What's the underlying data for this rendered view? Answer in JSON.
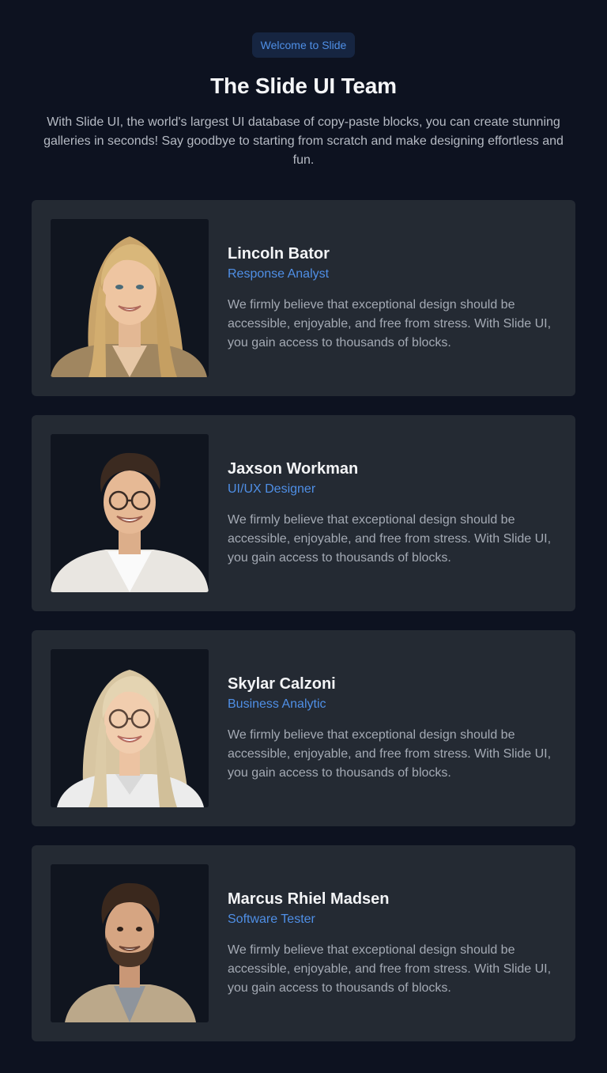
{
  "header": {
    "badge": "Welcome to Slide",
    "title": "The Slide UI Team",
    "lead": "With Slide UI, the world's largest UI database of copy-paste blocks, you can create stunning galleries in seconds! Say goodbye to starting from scratch and make designing effortless and fun."
  },
  "team": [
    {
      "name": "Lincoln Bator",
      "role": "Response Analyst",
      "bio": "We firmly believe that exceptional design should be accessible, enjoyable, and free from stress. With Slide UI, you gain access to thousands of blocks.",
      "photo_icon": "portrait-woman-long-blonde-hair"
    },
    {
      "name": "Jaxson Workman",
      "role": "UI/UX Designer",
      "bio": "We firmly believe that exceptional design should be accessible, enjoyable, and free from stress. With Slide UI, you gain access to thousands of blocks.",
      "photo_icon": "portrait-man-glasses"
    },
    {
      "name": "Skylar Calzoni",
      "role": "Business Analytic",
      "bio": "We firmly believe that exceptional design should be accessible, enjoyable, and free from stress. With Slide UI, you gain access to thousands of blocks.",
      "photo_icon": "portrait-woman-glasses"
    },
    {
      "name": "Marcus Rhiel Madsen",
      "role": "Software Tester",
      "bio": "We firmly believe that exceptional design should be accessible, enjoyable, and free from stress. With Slide UI, you gain access to thousands of blocks.",
      "photo_icon": "portrait-man-beard"
    }
  ],
  "colors": {
    "background": "#0d1220",
    "card": "#242a33",
    "accent": "#4f8fe6",
    "badge_bg": "#162541"
  }
}
